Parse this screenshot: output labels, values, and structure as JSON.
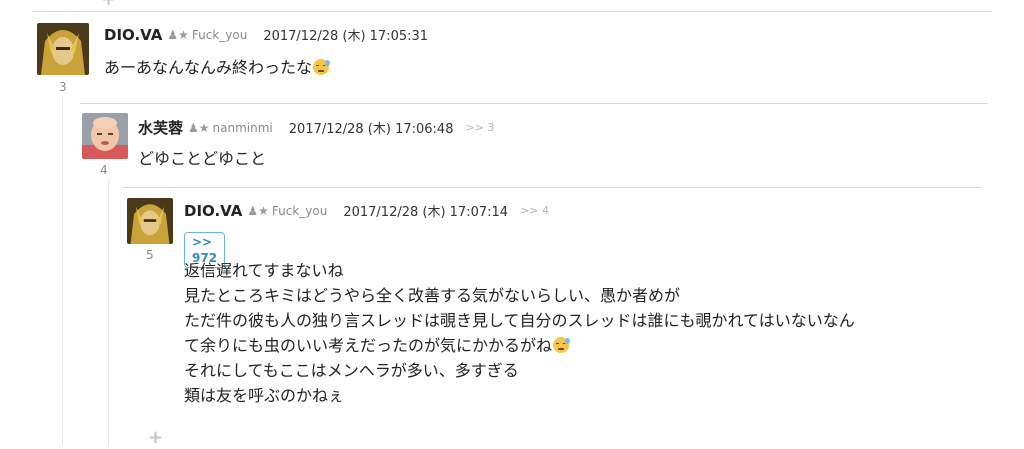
{
  "posts": [
    {
      "number": "3",
      "username": "DIO.VA",
      "user_id": "Fuck_you",
      "datetime": "2017/12/28 (木) 17:05:31",
      "anchor": "",
      "lines": [
        "あーあなんなんみ終わったな"
      ]
    },
    {
      "number": "4",
      "username": "水芙蓉",
      "user_id": "nanminmi",
      "datetime": "2017/12/28 (木) 17:06:48",
      "anchor": ">> 3",
      "lines": [
        "どゆことどゆこと"
      ]
    },
    {
      "number": "5",
      "username": "DIO.VA",
      "user_id": "Fuck_you",
      "datetime": "2017/12/28 (木) 17:07:14",
      "anchor": ">> 4",
      "reply_tag": ">> 972",
      "lines": [
        "返信遅れてすまないね",
        "見たところキミはどうやら全く改善する気がないらしい、愚か者めが",
        "ただ件の彼も人の独り言スレッドは覗き見して自分のスレッドは誰にも覗かれてはいないなん",
        "て余りにも虫のいい考えだったのが気にかかるがね",
        "それにしてもここはメンヘラが多い、多すぎる",
        "類は友を呼ぶのかねぇ"
      ]
    }
  ],
  "icons": {
    "user_badge": "user-star-icon",
    "emoji": "sweat-smile-emoji",
    "expand": "plus-icon"
  },
  "colors": {
    "reply_tag": "#2f8cc4",
    "divider": "#d9d9d9"
  }
}
